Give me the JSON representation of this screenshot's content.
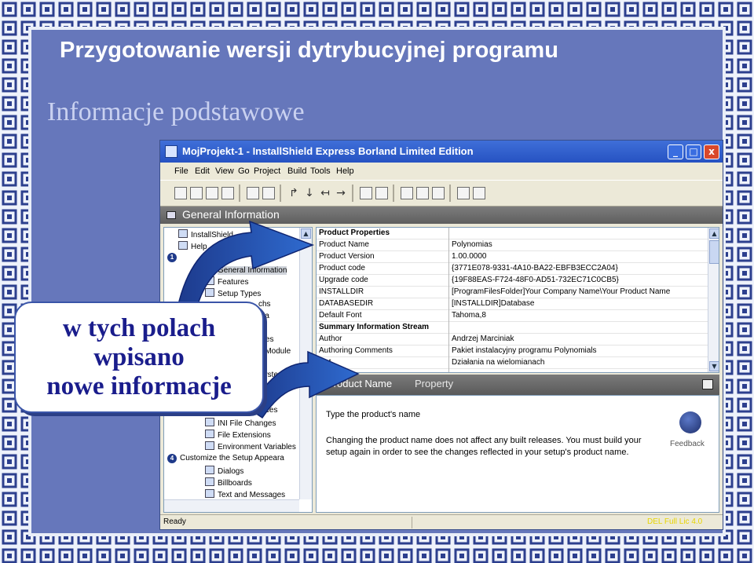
{
  "slide": {
    "title": "Przygotowanie wersji dytrybucyjnej programu",
    "subtitle": "Informacje podstawowe",
    "callout": [
      "w tych polach",
      "wpisano",
      "nowe informacje"
    ]
  },
  "window": {
    "title": "MojProjekt-1 - InstallShield Express Borland Limited Edition",
    "controls": [
      "_",
      "□",
      "x"
    ],
    "menu": [
      "File",
      "Edit",
      "View",
      "Go",
      "Project",
      "Build",
      "Tools",
      "Help"
    ],
    "panel_title": "General Information",
    "tree": [
      {
        "label": "InstallShield",
        "indent": 0,
        "type": "item"
      },
      {
        "label": "Help",
        "indent": 0,
        "type": "item"
      },
      {
        "label": "",
        "indent": 0,
        "type": "step",
        "num": "1"
      },
      {
        "label": "General Information",
        "indent": 2,
        "type": "item",
        "selected": true
      },
      {
        "label": "Features",
        "indent": 2,
        "type": "item"
      },
      {
        "label": "Setup Types",
        "indent": 2,
        "type": "item"
      },
      {
        "label": "chs",
        "indent": 2,
        "type": "item"
      },
      {
        "label": "ata",
        "indent": 2,
        "type": "item"
      },
      {
        "label": "",
        "indent": 0,
        "type": "item"
      },
      {
        "label": "ures",
        "indent": 2,
        "type": "item"
      },
      {
        "label": "e Module",
        "indent": 2,
        "type": "item"
      },
      {
        "label": "",
        "indent": 0,
        "type": "item"
      },
      {
        "label": "System",
        "indent": 2,
        "type": "item"
      },
      {
        "label": "er",
        "indent": 2,
        "type": "item"
      },
      {
        "label": "",
        "indent": 0,
        "type": "item"
      },
      {
        "label": "urces",
        "indent": 2,
        "type": "item"
      },
      {
        "label": "INI File Changes",
        "indent": 2,
        "type": "item"
      },
      {
        "label": "File Extensions",
        "indent": 2,
        "type": "item"
      },
      {
        "label": "Environment Variables",
        "indent": 2,
        "type": "item"
      },
      {
        "label": "Customize the Setup Appeara",
        "indent": 0,
        "type": "step",
        "num": "4"
      },
      {
        "label": "Dialogs",
        "indent": 2,
        "type": "item"
      },
      {
        "label": "Billboards",
        "indent": 2,
        "type": "item"
      },
      {
        "label": "Text and Messages",
        "indent": 2,
        "type": "item"
      }
    ],
    "properties": [
      {
        "key": "Product Properties",
        "value": "",
        "section": true
      },
      {
        "key": "Product Name",
        "value": "Polynomias"
      },
      {
        "key": "Product Version",
        "value": "1.00.0000"
      },
      {
        "key": "Product code",
        "value": "{3771E078-9331-4A10-BA22-EBFB3ECC2A04}"
      },
      {
        "key": "Upgrade code",
        "value": "{19F88EAS-F724-48F0-AD51-732EC71C0CB5}"
      },
      {
        "key": "INSTALLDIR",
        "value": "[ProgramFilesFolder]Your Company Name\\Your Product Name"
      },
      {
        "key": "DATABASEDIR",
        "value": "[INSTALLDIR]Database"
      },
      {
        "key": "Default Font",
        "value": "Tahoma,8"
      },
      {
        "key": "Summary Information Stream",
        "value": "",
        "section": true
      },
      {
        "key": "Author",
        "value": "Andrzej Marciniak"
      },
      {
        "key": "Authoring Comments",
        "value": "Pakiet instalacyjny programu Polynomials"
      },
      {
        "key": "ject",
        "value": "Działania na wielomianach"
      }
    ],
    "help": {
      "heading_name": "Product Name",
      "heading_prop": "Property",
      "line1": "Type the product's name",
      "line2": "Changing the product name does not affect any built releases. You must build your setup again in order to see the changes reflected in your setup's product name.",
      "feedback": "Feedback"
    },
    "status": "Ready",
    "status_right": "DEL  Full Lic 4.0"
  },
  "colors": {
    "slide_bg": "#6677bb",
    "border_pattern": "#2c3f8e",
    "titlebar": "#2652c2",
    "callout_text": "#1a1d8c"
  }
}
